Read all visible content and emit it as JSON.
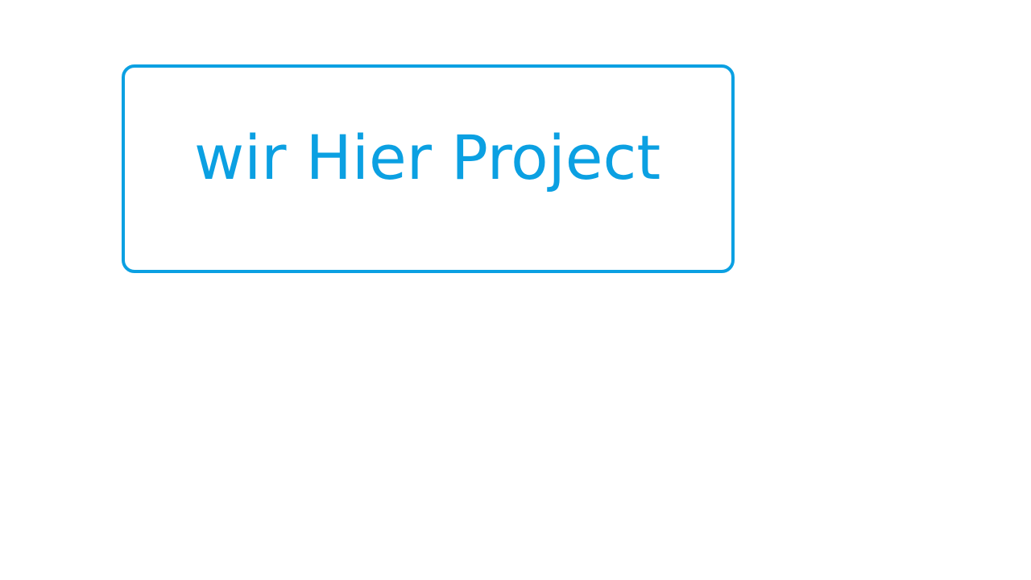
{
  "slide": {
    "title": "wir Hier Project"
  },
  "colors": {
    "accent": "#0ba0e2",
    "background": "#ffffff"
  }
}
